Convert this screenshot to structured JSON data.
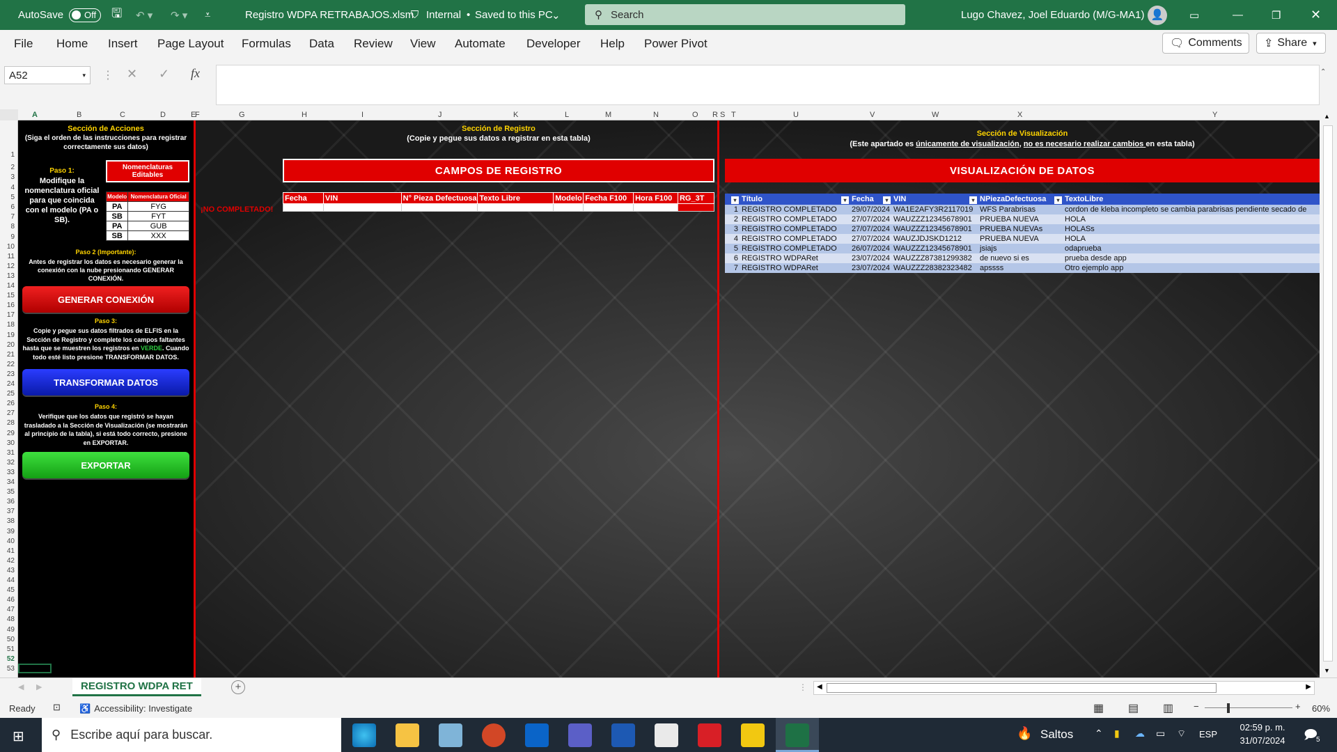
{
  "titlebar": {
    "autosave_label": "AutoSave",
    "autosave_state": "Off",
    "filename": "Registro WDPA RETRABAJOS.xlsm",
    "sensitivity": "Internal",
    "save_status": "Saved to this PC",
    "search_placeholder": "Search",
    "user": "Lugo Chavez, Joel Eduardo (M/G-MA1)"
  },
  "menu": {
    "items": [
      "File",
      "Home",
      "Insert",
      "Page Layout",
      "Formulas",
      "Data",
      "Review",
      "View",
      "Automate",
      "Developer",
      "Help",
      "Power Pivot"
    ],
    "comments_label": "Comments",
    "share_label": "Share"
  },
  "formula_bar": {
    "name_box": "A52",
    "fx": "fx",
    "formula": ""
  },
  "columns": [
    "A",
    "B",
    "C",
    "D",
    "E",
    "F",
    "G",
    "H",
    "I",
    "J",
    "K",
    "L",
    "M",
    "N",
    "O",
    "R",
    "S",
    "T",
    "U",
    "V",
    "W",
    "X",
    "Y"
  ],
  "rows": [
    "1",
    "2",
    "3",
    "4",
    "5",
    "6",
    "7",
    "8",
    "9",
    "10",
    "11",
    "12",
    "13",
    "14",
    "15",
    "16",
    "17",
    "18",
    "19",
    "20",
    "21",
    "22",
    "23",
    "24",
    "25",
    "26",
    "27",
    "28",
    "29",
    "30",
    "31",
    "32",
    "33",
    "34",
    "35",
    "36",
    "37",
    "38",
    "39",
    "40",
    "41",
    "42",
    "43",
    "44",
    "45",
    "46",
    "47",
    "48",
    "49",
    "50",
    "51",
    "52",
    "53"
  ],
  "actions": {
    "title": "Sección de Acciones",
    "subtitle": "(Siga el orden de las instrucciones para registrar correctamente sus datos)",
    "step1_title": "Paso 1:",
    "step1_text": "Modifique la nomenclatura oficial para que coincida con el modelo (PA o SB).",
    "nom_header": "Nomenclaturas Editables",
    "nom_col1": "Modelo",
    "nom_col2": "Nomenclatura Oficial",
    "nom_rows": [
      [
        "PA",
        "FYG"
      ],
      [
        "SB",
        "FYT"
      ],
      [
        "PA",
        "GUB"
      ],
      [
        "SB",
        "XXX"
      ]
    ],
    "step2_title": "Paso 2 (Importante):",
    "step2_text": "Antes de registrar los datos es necesario generar la conexión con la nube presionando GENERAR CONEXIÓN.",
    "btn_connect": "GENERAR CONEXIÓN",
    "step3_title": "Paso 3:",
    "step3_text_a": "Copie y pegue sus datos filtrados de ELFIS  en la Sección de Registro y complete los campos faltantes hasta que se muestren los registros en ",
    "step3_green": "VERDE",
    "step3_text_b": ". Cuando todo esté listo presione TRANSFORMAR DATOS.",
    "btn_transform": "TRANSFORMAR DATOS",
    "step4_title": "Paso 4:",
    "step4_text": "Verifique que los datos que registró se hayan trasladado a la Sección de Visualización (se mostrarán al principio de la tabla), si está todo correcto, presione en EXPORTAR.",
    "btn_export": "EXPORTAR"
  },
  "registro": {
    "title": "Sección de Registro",
    "subtitle": "(Copie y pegue sus datos a registrar en esta tabla)",
    "banner": "CAMPOS DE REGISTRO",
    "status": "¡NO COMPLETADO!",
    "headers": [
      "Fecha",
      "VIN",
      "N° Pieza Defectuosa",
      "Texto Libre",
      "Modelo",
      "Fecha F100",
      "Hora F100",
      "RG_3T"
    ]
  },
  "visualizacion": {
    "title": "Sección de Visualización",
    "sub_a": "(Este apartado es ",
    "sub_u1": "únicamente de visualización",
    "sub_b": ", ",
    "sub_u2": "no es necesario realizar cambios ",
    "sub_c": "en esta tabla)",
    "banner": "VISUALIZACIÓN DE DATOS",
    "headers": [
      "Título",
      "Fecha",
      "VIN",
      "NPiezaDefectuosa",
      "TextoLibre"
    ],
    "rows": [
      [
        "1",
        "REGISTRO COMPLETADO",
        "29/07/2024",
        "WA1E2AFY3R2117019",
        "WFS Parabrisas",
        "cordon de kleba incompleto se cambia parabrisas pendiente secado de"
      ],
      [
        "2",
        "REGISTRO COMPLETADO",
        "27/07/2024",
        "WAUZZZ12345678901",
        "PRUEBA NUEVA",
        "HOLA"
      ],
      [
        "3",
        "REGISTRO COMPLETADO",
        "27/07/2024",
        "WAUZZZ12345678901",
        "PRUEBA NUEVAs",
        "HOLASs"
      ],
      [
        "4",
        "REGISTRO COMPLETADO",
        "27/07/2024",
        "WAUZJDJSKD1212",
        "PRUEBA NUEVA",
        "HOLA"
      ],
      [
        "5",
        "REGISTRO COMPLETADO",
        "26/07/2024",
        "WAUZZZ12345678901",
        "jsiajs",
        "odaprueba"
      ],
      [
        "6",
        "REGISTRO WDPARet",
        "23/07/2024",
        "WAUZZZ87381299382",
        "de nuevo si es",
        "prueba desde app"
      ],
      [
        "7",
        "REGISTRO WDPARet",
        "23/07/2024",
        "WAUZZZ28382323482",
        "apssss",
        "Otro ejemplo app"
      ]
    ]
  },
  "sheet_tab": "REGISTRO WDPA RET",
  "status": {
    "ready": "Ready",
    "accessibility": "Accessibility: Investigate",
    "zoom": "60%"
  },
  "taskbar": {
    "search_placeholder": "Escribe aquí para buscar.",
    "weather": "Saltos",
    "lang": "ESP",
    "time": "02:59 p. m.",
    "date": "31/07/2024",
    "notif_count": "5"
  }
}
